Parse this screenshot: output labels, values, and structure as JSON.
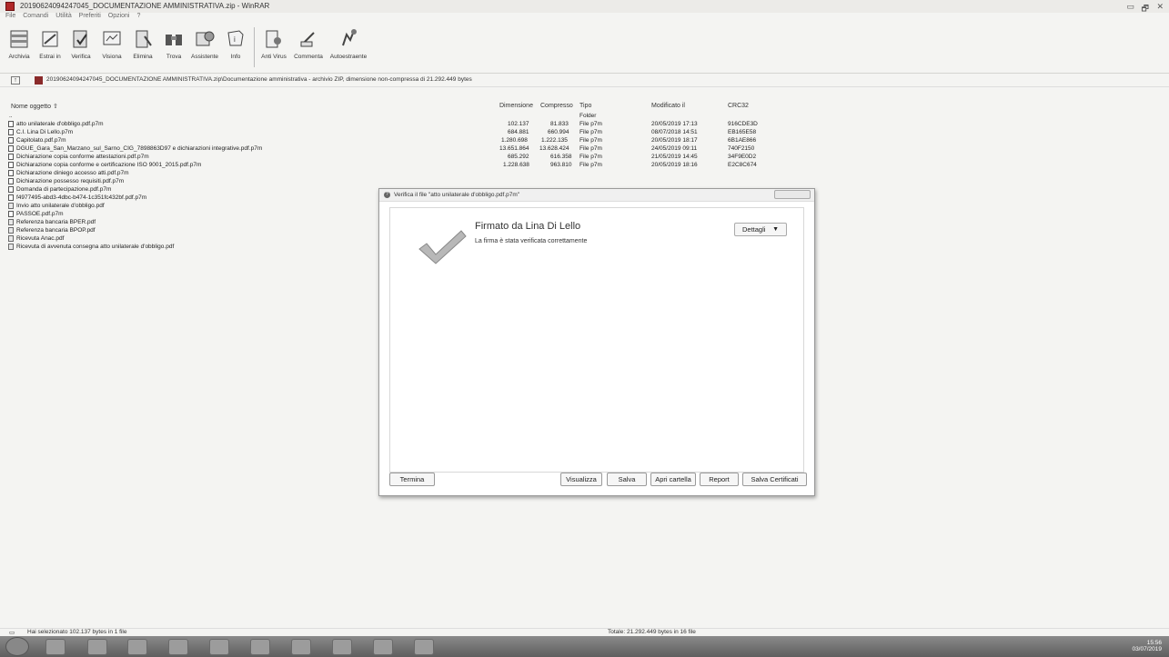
{
  "window": {
    "title": "20190624094247045_DOCUMENTAZIONE AMMINISTRATIVA.zip - WinRAR"
  },
  "menu": [
    "File",
    "Comandi",
    "Utilità",
    "Preferiti",
    "Opzioni",
    "?"
  ],
  "toolbar": [
    {
      "label": "Archivia",
      "icon": "archive-add-icon"
    },
    {
      "label": "Estrai in",
      "icon": "extract-icon"
    },
    {
      "label": "Verifica",
      "icon": "test-icon"
    },
    {
      "label": "Visiona",
      "icon": "view-icon"
    },
    {
      "label": "Elimina",
      "icon": "delete-icon"
    },
    {
      "label": "Trova",
      "icon": "find-icon"
    },
    {
      "label": "Assistente",
      "icon": "wizard-icon"
    },
    {
      "label": "Info",
      "icon": "info-icon"
    },
    {
      "label": "Anti Virus",
      "icon": "antivirus-icon"
    },
    {
      "label": "Commenta",
      "icon": "comment-icon"
    },
    {
      "label": "Autoestraente",
      "icon": "sfx-icon"
    }
  ],
  "address": {
    "path": "20190624094247045_DOCUMENTAZIONE AMMINISTRATIVA.zip\\Documentazione amministrativa - archivio ZIP, dimensione non-compressa di 21.292.449 bytes"
  },
  "columns": {
    "name": "Nome oggetto",
    "size": "Dimensione",
    "packed": "Compresso",
    "type": "Tipo",
    "modified": "Modificato il",
    "crc": "CRC32"
  },
  "files": [
    {
      "name": "..",
      "size": "",
      "packed": "",
      "type": "Folder",
      "modified": "",
      "crc": "",
      "kind": "folder"
    },
    {
      "name": "atto unilaterale d'obbligo.pdf.p7m",
      "size": "102.137",
      "packed": "81.833",
      "type": "File p7m",
      "modified": "20/05/2019 17:13",
      "crc": "916CDE3D",
      "kind": "p7m"
    },
    {
      "name": "C.I. Lina Di Lello.p7m",
      "size": "684.881",
      "packed": "660.994",
      "type": "File p7m",
      "modified": "08/07/2018 14:51",
      "crc": "EB165E58",
      "kind": "p7m"
    },
    {
      "name": "Capitolato.pdf.p7m",
      "size": "1.280.698",
      "packed": "1.222.135",
      "type": "File p7m",
      "modified": "20/05/2019 18:17",
      "crc": "6B1AE866",
      "kind": "p7m"
    },
    {
      "name": "DGUE_Gara_San_Marzano_sul_Sarno_CIG_7898863D97 e dichiarazioni integrative.pdf.p7m",
      "size": "13.651.864",
      "packed": "13.628.424",
      "type": "File p7m",
      "modified": "24/05/2019 09:11",
      "crc": "740F2150",
      "kind": "p7m"
    },
    {
      "name": "Dichiarazione copia conforme attestazioni.pdf.p7m",
      "size": "685.292",
      "packed": "616.358",
      "type": "File p7m",
      "modified": "21/05/2019 14:45",
      "crc": "34F9E0D2",
      "kind": "p7m"
    },
    {
      "name": "Dichiarazione copia conforme e certificazione ISO 9001_2015.pdf.p7m",
      "size": "1.228.638",
      "packed": "963.810",
      "type": "File p7m",
      "modified": "20/05/2019 18:16",
      "crc": "E2C8C674",
      "kind": "p7m"
    },
    {
      "name": "Dichiarazione diniego accesso atti.pdf.p7m",
      "size": "",
      "packed": "",
      "type": "",
      "modified": "",
      "crc": "",
      "kind": "p7m"
    },
    {
      "name": "Dichiarazione possesso requisiti.pdf.p7m",
      "size": "",
      "packed": "",
      "type": "",
      "modified": "",
      "crc": "",
      "kind": "p7m"
    },
    {
      "name": "Domanda di partecipazione.pdf.p7m",
      "size": "",
      "packed": "",
      "type": "",
      "modified": "",
      "crc": "",
      "kind": "p7m"
    },
    {
      "name": "f4977495-abd3-4dbc-b474-1c351fc432bf.pdf.p7m",
      "size": "",
      "packed": "",
      "type": "",
      "modified": "",
      "crc": "",
      "kind": "p7m"
    },
    {
      "name": "Invio atto unilaterale d'obbligo.pdf",
      "size": "",
      "packed": "",
      "type": "",
      "modified": "",
      "crc": "",
      "kind": "pdf"
    },
    {
      "name": "PASSOE.pdf.p7m",
      "size": "",
      "packed": "",
      "type": "",
      "modified": "",
      "crc": "",
      "kind": "p7m"
    },
    {
      "name": "Referenza bancaria BPER.pdf",
      "size": "",
      "packed": "",
      "type": "",
      "modified": "",
      "crc": "",
      "kind": "pdf"
    },
    {
      "name": "Referenza bancaria BPOP.pdf",
      "size": "",
      "packed": "",
      "type": "",
      "modified": "",
      "crc": "",
      "kind": "pdf"
    },
    {
      "name": "Ricevuta Anac.pdf",
      "size": "",
      "packed": "",
      "type": "",
      "modified": "",
      "crc": "",
      "kind": "pdf"
    },
    {
      "name": "Ricevuta di avvenuta consegna atto unilaterale d'obbligo.pdf",
      "size": "",
      "packed": "",
      "type": "",
      "modified": "",
      "crc": "",
      "kind": "pdf"
    }
  ],
  "status": {
    "selected": "Hai selezionato 102.137 bytes in 1 file",
    "total": "Totale: 21.292.449 bytes in 16 file"
  },
  "dialog": {
    "title": "Verifica il file \"atto unilaterale d'obbligo.pdf.p7m\"",
    "signer": "Firmato da Lina Di Lello",
    "message": "La firma è stata verificata correttamente",
    "details_label": "Dettagli",
    "buttons": {
      "close": "Termina",
      "view": "Visualizza",
      "save": "Salva",
      "open_folder": "Apri cartella",
      "report": "Report",
      "save_cert": "Salva Certificati"
    }
  },
  "tray": {
    "time": "15:56",
    "date": "03/07/2019"
  }
}
